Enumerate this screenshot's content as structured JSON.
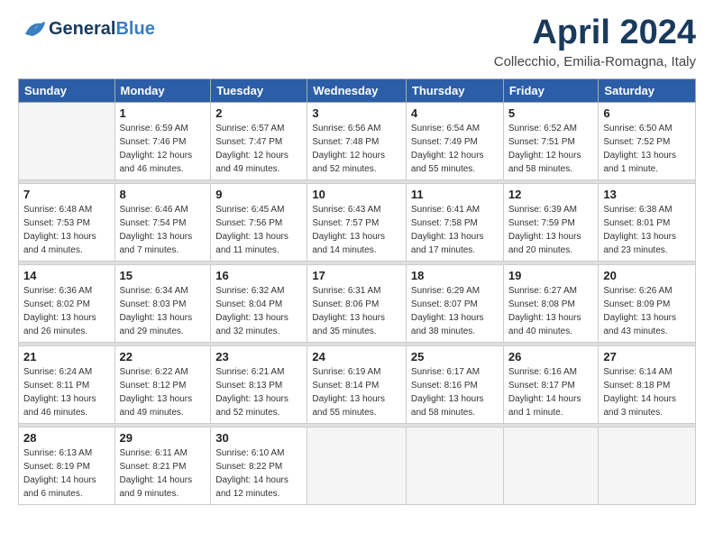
{
  "logo": {
    "general": "General",
    "blue": "Blue"
  },
  "title": "April 2024",
  "subtitle": "Collecchio, Emilia-Romagna, Italy",
  "days_of_week": [
    "Sunday",
    "Monday",
    "Tuesday",
    "Wednesday",
    "Thursday",
    "Friday",
    "Saturday"
  ],
  "weeks": [
    [
      {
        "day": "",
        "sunrise": "",
        "sunset": "",
        "daylight": ""
      },
      {
        "day": "1",
        "sunrise": "Sunrise: 6:59 AM",
        "sunset": "Sunset: 7:46 PM",
        "daylight": "Daylight: 12 hours and 46 minutes."
      },
      {
        "day": "2",
        "sunrise": "Sunrise: 6:57 AM",
        "sunset": "Sunset: 7:47 PM",
        "daylight": "Daylight: 12 hours and 49 minutes."
      },
      {
        "day": "3",
        "sunrise": "Sunrise: 6:56 AM",
        "sunset": "Sunset: 7:48 PM",
        "daylight": "Daylight: 12 hours and 52 minutes."
      },
      {
        "day": "4",
        "sunrise": "Sunrise: 6:54 AM",
        "sunset": "Sunset: 7:49 PM",
        "daylight": "Daylight: 12 hours and 55 minutes."
      },
      {
        "day": "5",
        "sunrise": "Sunrise: 6:52 AM",
        "sunset": "Sunset: 7:51 PM",
        "daylight": "Daylight: 12 hours and 58 minutes."
      },
      {
        "day": "6",
        "sunrise": "Sunrise: 6:50 AM",
        "sunset": "Sunset: 7:52 PM",
        "daylight": "Daylight: 13 hours and 1 minute."
      }
    ],
    [
      {
        "day": "7",
        "sunrise": "Sunrise: 6:48 AM",
        "sunset": "Sunset: 7:53 PM",
        "daylight": "Daylight: 13 hours and 4 minutes."
      },
      {
        "day": "8",
        "sunrise": "Sunrise: 6:46 AM",
        "sunset": "Sunset: 7:54 PM",
        "daylight": "Daylight: 13 hours and 7 minutes."
      },
      {
        "day": "9",
        "sunrise": "Sunrise: 6:45 AM",
        "sunset": "Sunset: 7:56 PM",
        "daylight": "Daylight: 13 hours and 11 minutes."
      },
      {
        "day": "10",
        "sunrise": "Sunrise: 6:43 AM",
        "sunset": "Sunset: 7:57 PM",
        "daylight": "Daylight: 13 hours and 14 minutes."
      },
      {
        "day": "11",
        "sunrise": "Sunrise: 6:41 AM",
        "sunset": "Sunset: 7:58 PM",
        "daylight": "Daylight: 13 hours and 17 minutes."
      },
      {
        "day": "12",
        "sunrise": "Sunrise: 6:39 AM",
        "sunset": "Sunset: 7:59 PM",
        "daylight": "Daylight: 13 hours and 20 minutes."
      },
      {
        "day": "13",
        "sunrise": "Sunrise: 6:38 AM",
        "sunset": "Sunset: 8:01 PM",
        "daylight": "Daylight: 13 hours and 23 minutes."
      }
    ],
    [
      {
        "day": "14",
        "sunrise": "Sunrise: 6:36 AM",
        "sunset": "Sunset: 8:02 PM",
        "daylight": "Daylight: 13 hours and 26 minutes."
      },
      {
        "day": "15",
        "sunrise": "Sunrise: 6:34 AM",
        "sunset": "Sunset: 8:03 PM",
        "daylight": "Daylight: 13 hours and 29 minutes."
      },
      {
        "day": "16",
        "sunrise": "Sunrise: 6:32 AM",
        "sunset": "Sunset: 8:04 PM",
        "daylight": "Daylight: 13 hours and 32 minutes."
      },
      {
        "day": "17",
        "sunrise": "Sunrise: 6:31 AM",
        "sunset": "Sunset: 8:06 PM",
        "daylight": "Daylight: 13 hours and 35 minutes."
      },
      {
        "day": "18",
        "sunrise": "Sunrise: 6:29 AM",
        "sunset": "Sunset: 8:07 PM",
        "daylight": "Daylight: 13 hours and 38 minutes."
      },
      {
        "day": "19",
        "sunrise": "Sunrise: 6:27 AM",
        "sunset": "Sunset: 8:08 PM",
        "daylight": "Daylight: 13 hours and 40 minutes."
      },
      {
        "day": "20",
        "sunrise": "Sunrise: 6:26 AM",
        "sunset": "Sunset: 8:09 PM",
        "daylight": "Daylight: 13 hours and 43 minutes."
      }
    ],
    [
      {
        "day": "21",
        "sunrise": "Sunrise: 6:24 AM",
        "sunset": "Sunset: 8:11 PM",
        "daylight": "Daylight: 13 hours and 46 minutes."
      },
      {
        "day": "22",
        "sunrise": "Sunrise: 6:22 AM",
        "sunset": "Sunset: 8:12 PM",
        "daylight": "Daylight: 13 hours and 49 minutes."
      },
      {
        "day": "23",
        "sunrise": "Sunrise: 6:21 AM",
        "sunset": "Sunset: 8:13 PM",
        "daylight": "Daylight: 13 hours and 52 minutes."
      },
      {
        "day": "24",
        "sunrise": "Sunrise: 6:19 AM",
        "sunset": "Sunset: 8:14 PM",
        "daylight": "Daylight: 13 hours and 55 minutes."
      },
      {
        "day": "25",
        "sunrise": "Sunrise: 6:17 AM",
        "sunset": "Sunset: 8:16 PM",
        "daylight": "Daylight: 13 hours and 58 minutes."
      },
      {
        "day": "26",
        "sunrise": "Sunrise: 6:16 AM",
        "sunset": "Sunset: 8:17 PM",
        "daylight": "Daylight: 14 hours and 1 minute."
      },
      {
        "day": "27",
        "sunrise": "Sunrise: 6:14 AM",
        "sunset": "Sunset: 8:18 PM",
        "daylight": "Daylight: 14 hours and 3 minutes."
      }
    ],
    [
      {
        "day": "28",
        "sunrise": "Sunrise: 6:13 AM",
        "sunset": "Sunset: 8:19 PM",
        "daylight": "Daylight: 14 hours and 6 minutes."
      },
      {
        "day": "29",
        "sunrise": "Sunrise: 6:11 AM",
        "sunset": "Sunset: 8:21 PM",
        "daylight": "Daylight: 14 hours and 9 minutes."
      },
      {
        "day": "30",
        "sunrise": "Sunrise: 6:10 AM",
        "sunset": "Sunset: 8:22 PM",
        "daylight": "Daylight: 14 hours and 12 minutes."
      },
      {
        "day": "",
        "sunrise": "",
        "sunset": "",
        "daylight": ""
      },
      {
        "day": "",
        "sunrise": "",
        "sunset": "",
        "daylight": ""
      },
      {
        "day": "",
        "sunrise": "",
        "sunset": "",
        "daylight": ""
      },
      {
        "day": "",
        "sunrise": "",
        "sunset": "",
        "daylight": ""
      }
    ]
  ]
}
